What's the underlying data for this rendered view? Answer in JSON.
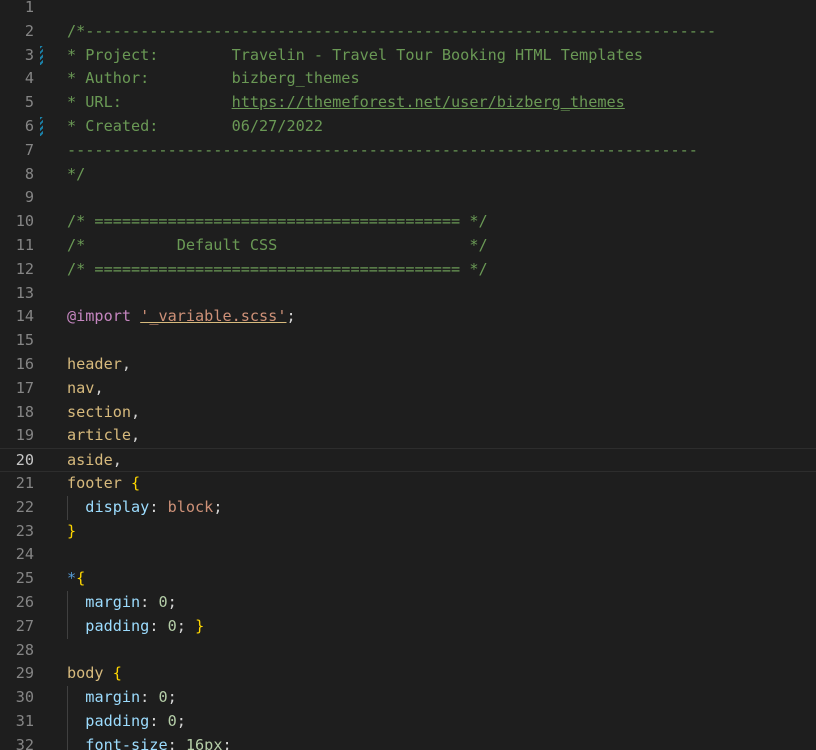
{
  "editor": {
    "lines": [
      {
        "n": "1",
        "mark": false,
        "tokens": []
      },
      {
        "n": "2",
        "mark": false,
        "tokens": [
          {
            "t": "comment",
            "v": "/*---------------------------------------------------------------------"
          }
        ]
      },
      {
        "n": "3",
        "mark": true,
        "tokens": [
          {
            "t": "comment",
            "v": "* Project:        Travelin - Travel Tour Booking HTML Templates"
          }
        ]
      },
      {
        "n": "4",
        "mark": false,
        "tokens": [
          {
            "t": "comment",
            "v": "* Author:         bizberg_themes"
          }
        ]
      },
      {
        "n": "5",
        "mark": false,
        "tokens": [
          {
            "t": "comment",
            "v": "* URL:            "
          },
          {
            "t": "link",
            "v": "https://themeforest.net/user/bizberg_themes"
          }
        ]
      },
      {
        "n": "6",
        "mark": true,
        "tokens": [
          {
            "t": "comment",
            "v": "* Created:        06/27/2022"
          }
        ]
      },
      {
        "n": "7",
        "mark": false,
        "tokens": [
          {
            "t": "comment",
            "v": "---------------------------------------------------------------------"
          }
        ]
      },
      {
        "n": "8",
        "mark": false,
        "tokens": [
          {
            "t": "comment",
            "v": "*/"
          }
        ]
      },
      {
        "n": "9",
        "mark": false,
        "tokens": []
      },
      {
        "n": "10",
        "mark": false,
        "tokens": [
          {
            "t": "comment",
            "v": "/* ======================================== */"
          }
        ]
      },
      {
        "n": "11",
        "mark": false,
        "tokens": [
          {
            "t": "comment",
            "v": "/*          Default CSS                     */"
          }
        ]
      },
      {
        "n": "12",
        "mark": false,
        "tokens": [
          {
            "t": "comment",
            "v": "/* ======================================== */"
          }
        ]
      },
      {
        "n": "13",
        "mark": false,
        "tokens": []
      },
      {
        "n": "14",
        "mark": false,
        "tokens": [
          {
            "t": "keyword",
            "v": "@import"
          },
          {
            "t": "text",
            "v": " "
          },
          {
            "t": "string",
            "v": "'_variable.scss'"
          },
          {
            "t": "text",
            "v": ";"
          }
        ]
      },
      {
        "n": "15",
        "mark": false,
        "tokens": []
      },
      {
        "n": "16",
        "mark": false,
        "tokens": [
          {
            "t": "selector",
            "v": "header"
          },
          {
            "t": "text",
            "v": ","
          }
        ]
      },
      {
        "n": "17",
        "mark": false,
        "tokens": [
          {
            "t": "selector",
            "v": "nav"
          },
          {
            "t": "text",
            "v": ","
          }
        ]
      },
      {
        "n": "18",
        "mark": false,
        "tokens": [
          {
            "t": "selector",
            "v": "section"
          },
          {
            "t": "text",
            "v": ","
          }
        ]
      },
      {
        "n": "19",
        "mark": false,
        "tokens": [
          {
            "t": "selector",
            "v": "article"
          },
          {
            "t": "text",
            "v": ","
          }
        ]
      },
      {
        "n": "20",
        "mark": false,
        "current": true,
        "tokens": [
          {
            "t": "selector",
            "v": "aside"
          },
          {
            "t": "text",
            "v": ","
          }
        ]
      },
      {
        "n": "21",
        "mark": false,
        "tokens": [
          {
            "t": "selector",
            "v": "footer"
          },
          {
            "t": "text",
            "v": " "
          },
          {
            "t": "bracket",
            "v": "{"
          }
        ]
      },
      {
        "n": "22",
        "mark": false,
        "guide": true,
        "tokens": [
          {
            "t": "text",
            "v": "  "
          },
          {
            "t": "property",
            "v": "display"
          },
          {
            "t": "text",
            "v": ": "
          },
          {
            "t": "value",
            "v": "block"
          },
          {
            "t": "text",
            "v": ";"
          }
        ]
      },
      {
        "n": "23",
        "mark": false,
        "tokens": [
          {
            "t": "bracket",
            "v": "}"
          }
        ]
      },
      {
        "n": "24",
        "mark": false,
        "tokens": []
      },
      {
        "n": "25",
        "mark": false,
        "tokens": [
          {
            "t": "universal",
            "v": "*"
          },
          {
            "t": "bracket",
            "v": "{"
          }
        ]
      },
      {
        "n": "26",
        "mark": false,
        "guide": true,
        "tokens": [
          {
            "t": "text",
            "v": "  "
          },
          {
            "t": "property",
            "v": "margin"
          },
          {
            "t": "text",
            "v": ": "
          },
          {
            "t": "number",
            "v": "0"
          },
          {
            "t": "text",
            "v": ";"
          }
        ]
      },
      {
        "n": "27",
        "mark": false,
        "guide": true,
        "tokens": [
          {
            "t": "text",
            "v": "  "
          },
          {
            "t": "property",
            "v": "padding"
          },
          {
            "t": "text",
            "v": ": "
          },
          {
            "t": "number",
            "v": "0"
          },
          {
            "t": "text",
            "v": "; "
          },
          {
            "t": "bracket",
            "v": "}"
          }
        ]
      },
      {
        "n": "28",
        "mark": false,
        "tokens": []
      },
      {
        "n": "29",
        "mark": false,
        "tokens": [
          {
            "t": "selector",
            "v": "body"
          },
          {
            "t": "text",
            "v": " "
          },
          {
            "t": "bracket",
            "v": "{"
          }
        ]
      },
      {
        "n": "30",
        "mark": false,
        "guide": true,
        "tokens": [
          {
            "t": "text",
            "v": "  "
          },
          {
            "t": "property",
            "v": "margin"
          },
          {
            "t": "text",
            "v": ": "
          },
          {
            "t": "number",
            "v": "0"
          },
          {
            "t": "text",
            "v": ";"
          }
        ]
      },
      {
        "n": "31",
        "mark": false,
        "guide": true,
        "tokens": [
          {
            "t": "text",
            "v": "  "
          },
          {
            "t": "property",
            "v": "padding"
          },
          {
            "t": "text",
            "v": ": "
          },
          {
            "t": "number",
            "v": "0"
          },
          {
            "t": "text",
            "v": ";"
          }
        ]
      },
      {
        "n": "32",
        "mark": false,
        "guide": true,
        "tokens": [
          {
            "t": "text",
            "v": "  "
          },
          {
            "t": "property",
            "v": "font-size"
          },
          {
            "t": "text",
            "v": ": "
          },
          {
            "t": "number",
            "v": "16px"
          },
          {
            "t": "text",
            "v": ";"
          }
        ]
      }
    ]
  }
}
